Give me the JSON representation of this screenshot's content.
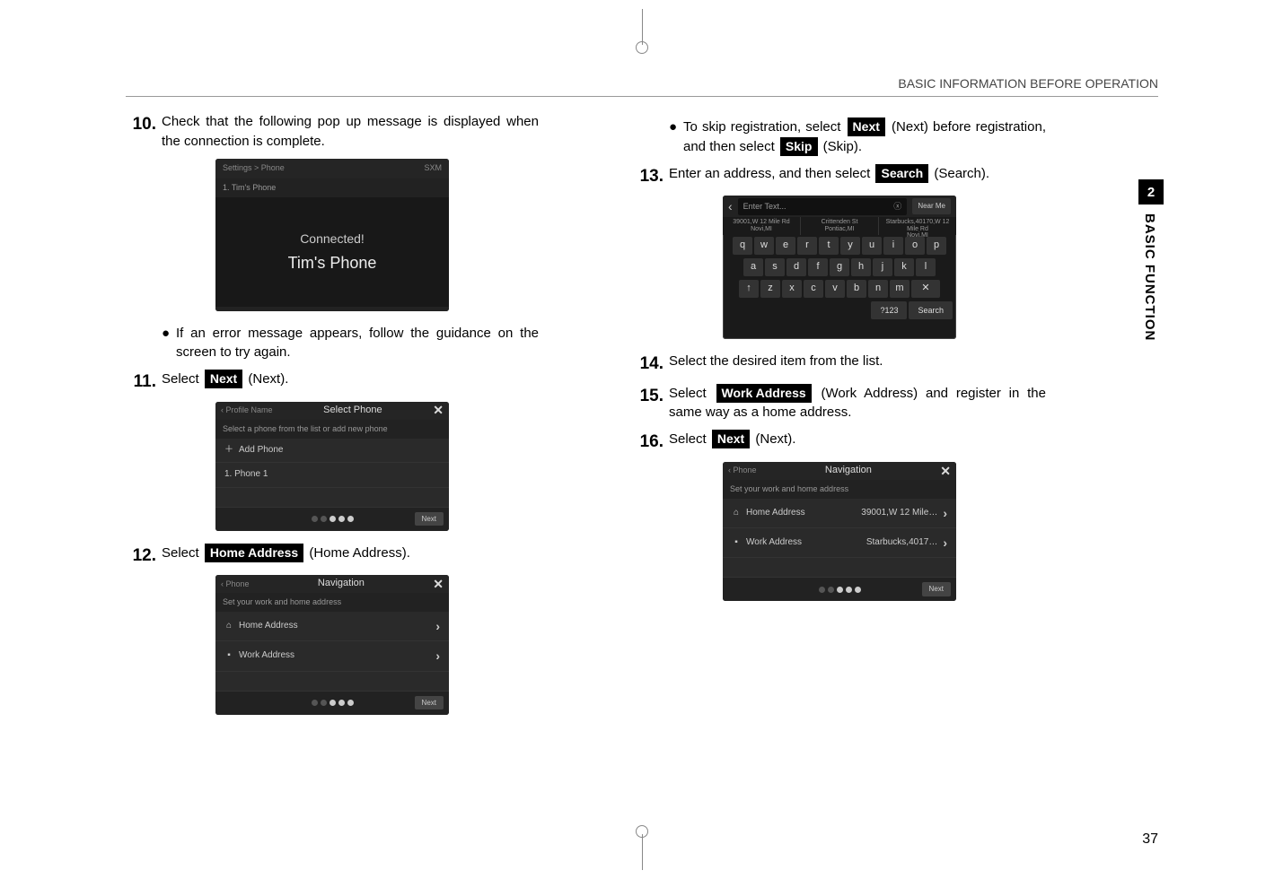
{
  "header": "BASIC INFORMATION BEFORE OPERATION",
  "pageNumber": "37",
  "sideTab": {
    "number": "2",
    "label": "BASIC FUNCTION"
  },
  "buttons": {
    "next": "Next",
    "skip": "Skip",
    "search": "Search",
    "homeAddress": "Home Address",
    "workAddress": "Work Address"
  },
  "left": {
    "step10": {
      "num": "10.",
      "text": "Check that the following pop up message is displayed when the connection is complete."
    },
    "ss1": {
      "topLeft": "Settings > Phone",
      "topRight": "SXM",
      "tab": "1. Tim's Phone",
      "connected": "Connected!",
      "name": "Tim's Phone"
    },
    "bullet10": "If an error message appears, follow the guidance on the screen to try again.",
    "step11": {
      "num": "11.",
      "before": "Select ",
      "after": " (Next)."
    },
    "ss2": {
      "back": "Profile Name",
      "title": "Select Phone",
      "sub": "Select a phone from the list or add new phone",
      "addPhone": "Add Phone",
      "phone1": "1.  Phone 1",
      "next": "Next"
    },
    "step12": {
      "num": "12.",
      "before": "Select ",
      "after": " (Home Address)."
    },
    "ss3": {
      "back": "Phone",
      "title": "Navigation",
      "sub": "Set your work and home address",
      "home": "Home Address",
      "work": "Work Address",
      "next": "Next"
    }
  },
  "right": {
    "bulletSkip": {
      "p1": "To skip registration, select ",
      "p2": " (Next) before registration, and then select ",
      "p3": " (Skip)."
    },
    "step13": {
      "num": "13.",
      "before": "Enter an address, and then select ",
      "after": " (Search)."
    },
    "ssK": {
      "placeholder": "Enter Text...",
      "nearMe": "Near Me",
      "sug1a": "39001,W 12 Mile Rd",
      "sug1b": "Novi,MI",
      "sug2a": "Crittenden St",
      "sug2b": "Pontiac,MI",
      "sug3a": "Starbucks,40170,W 12 Mile Rd",
      "sug3b": "Novi,MI",
      "row1": [
        "q",
        "w",
        "e",
        "r",
        "t",
        "y",
        "u",
        "i",
        "o",
        "p"
      ],
      "row2": [
        "a",
        "s",
        "d",
        "f",
        "g",
        "h",
        "j",
        "k",
        "l"
      ],
      "row3": [
        "↑",
        "z",
        "x",
        "c",
        "v",
        "b",
        "n",
        "m",
        "✕"
      ],
      "numKey": "?123",
      "searchKey": "Search"
    },
    "step14": {
      "num": "14.",
      "text": "Select the desired item from the list."
    },
    "step15": {
      "num": "15.",
      "before": "Select ",
      "after": " (Work Address) and register in the same way as a home address."
    },
    "step16": {
      "num": "16.",
      "before": "Select ",
      "after": " (Next)."
    },
    "ss4": {
      "back": "Phone",
      "title": "Navigation",
      "sub": "Set your work and home address",
      "home": "Home Address",
      "homeVal": "39001,W 12 Mile…",
      "work": "Work Address",
      "workVal": "Starbucks,4017…",
      "next": "Next"
    }
  }
}
